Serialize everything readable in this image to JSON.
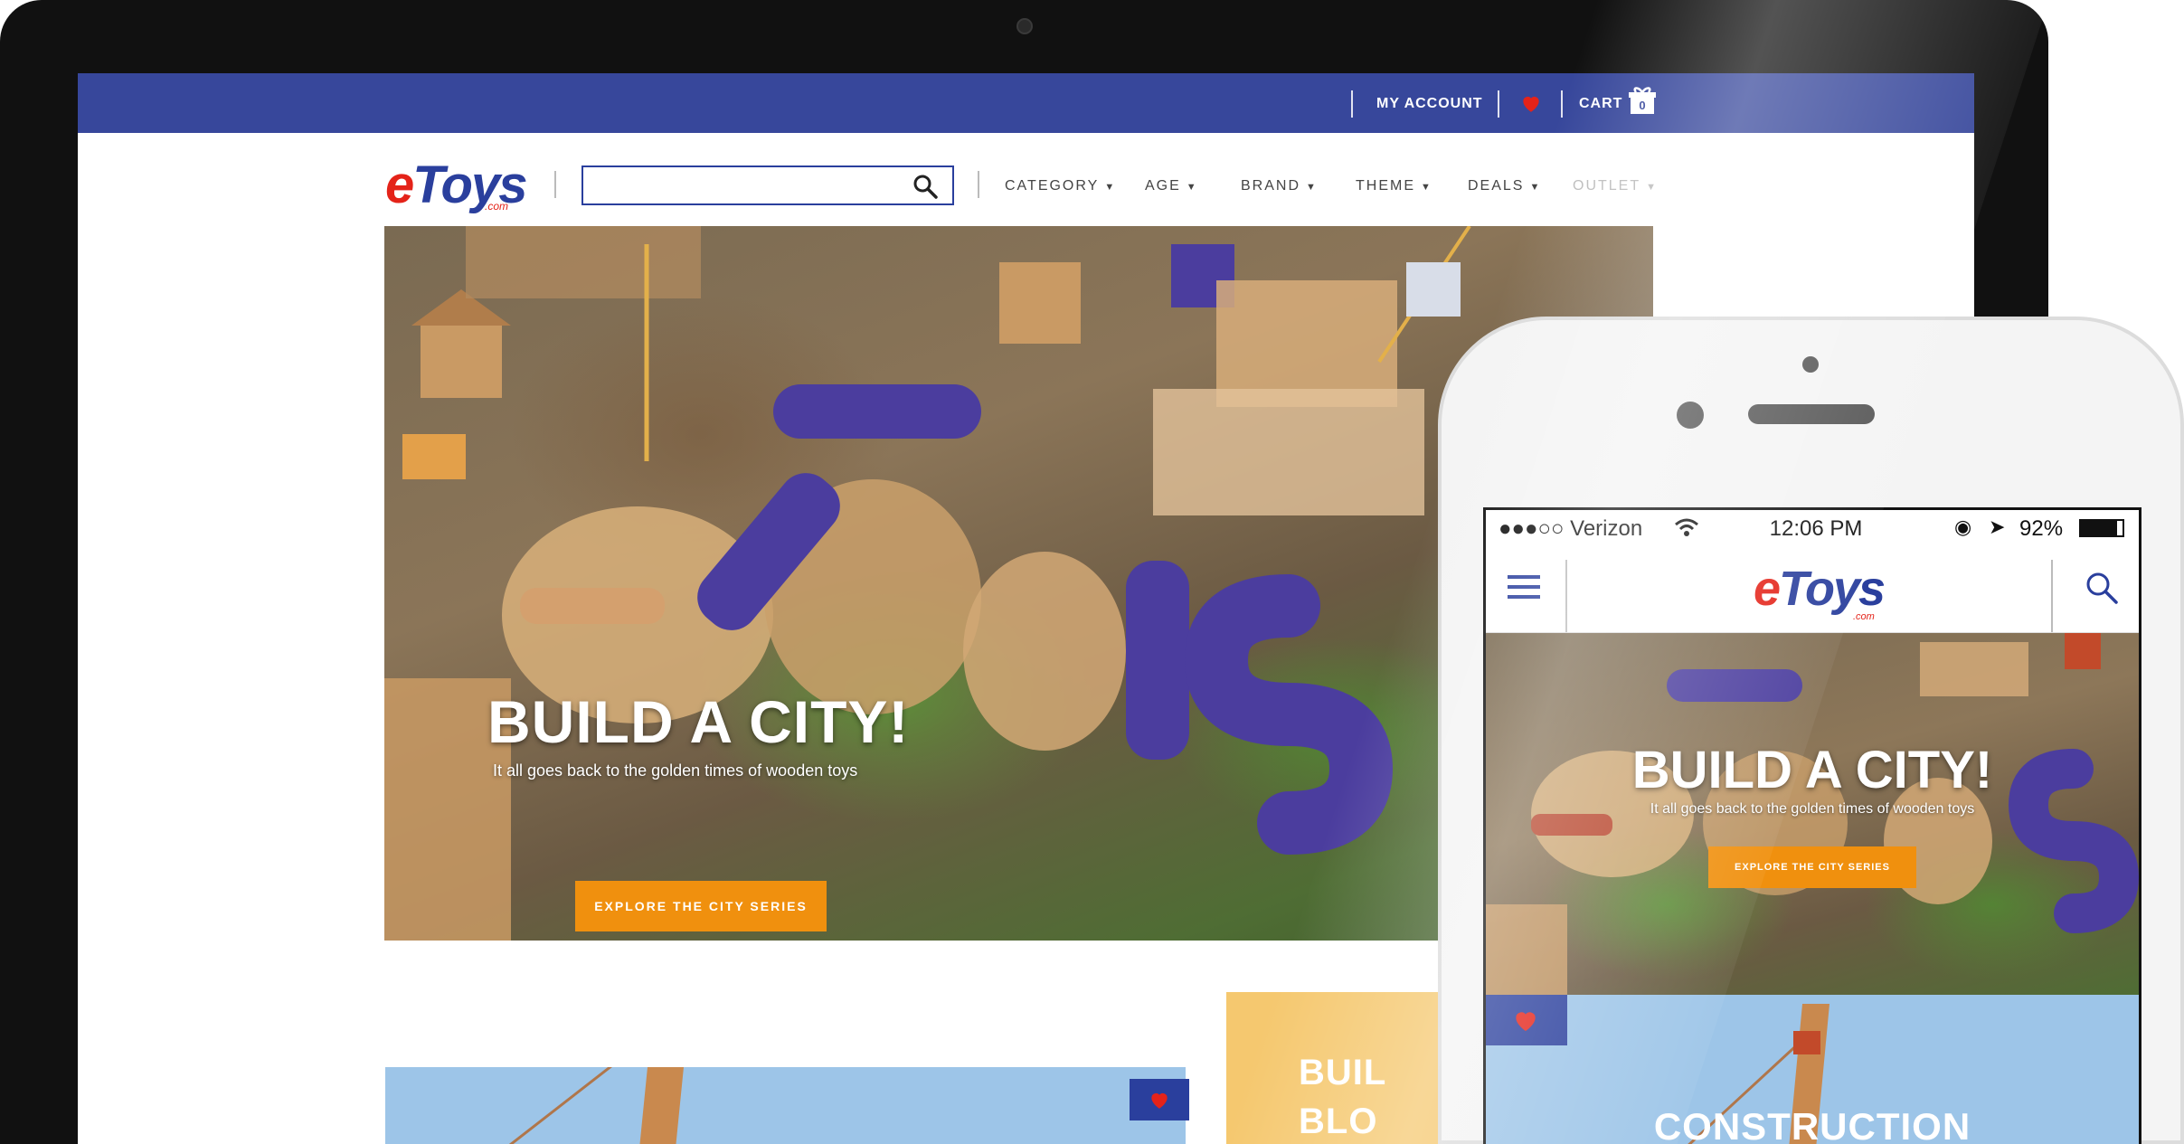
{
  "colors": {
    "brand_blue": "#37479b",
    "logo_red": "#e42319",
    "logo_blue": "#2a3f9d",
    "cta_orange": "#f0900e",
    "card_sky": "#9dc5e8",
    "card_yellow": "#f5c86f"
  },
  "desktop": {
    "topbar": {
      "my_account": "MY ACCOUNT",
      "cart": "CART",
      "cart_count": "0"
    },
    "logo": {
      "e": "e",
      "toys": "Toys",
      "com": ".com"
    },
    "search": {
      "placeholder": ""
    },
    "nav": [
      {
        "label": "CATEGORY"
      },
      {
        "label": "AGE"
      },
      {
        "label": "BRAND"
      },
      {
        "label": "THEME"
      },
      {
        "label": "DEALS"
      },
      {
        "label": "OUTLET"
      }
    ],
    "hero": {
      "title": "BUILD A CITY!",
      "subtitle": "It all goes back to the golden times of wooden toys",
      "cta": "EXPLORE THE CITY SERIES",
      "slides": 3,
      "active_slide": 1
    },
    "cards": {
      "right_text_line1": "BUIL",
      "right_text_line2": "BLO"
    }
  },
  "phone": {
    "status": {
      "carrier": "●●●○○ Verizon",
      "time": "12:06 PM",
      "battery": "92%"
    },
    "logo": {
      "e": "e",
      "toys": "Toys",
      "com": ".com"
    },
    "hero": {
      "title": "BUILD A CITY!",
      "subtitle": "It all goes back to the golden times of wooden toys",
      "cta": "EXPLORE THE CITY SERIES"
    },
    "card": {
      "text": "CONSTRUCTION"
    }
  },
  "icons": {
    "search": "search-icon",
    "heart": "heart-icon",
    "cart": "gift-cart-icon",
    "menu": "hamburger-menu-icon",
    "dropdown": "caret-down-icon"
  }
}
